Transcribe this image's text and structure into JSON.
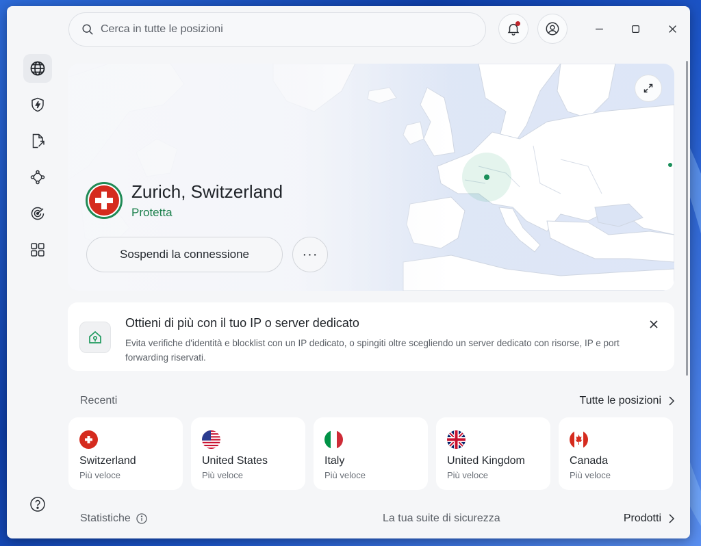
{
  "search": {
    "placeholder": "Cerca in tutte le posizioni"
  },
  "header": {
    "notifications_icon": "bell-icon",
    "account_icon": "account-icon",
    "window_controls": [
      "minimize",
      "maximize",
      "close"
    ]
  },
  "sidebar": {
    "items": [
      {
        "icon": "globe-icon",
        "active": true
      },
      {
        "icon": "shield-bolt-icon"
      },
      {
        "icon": "file-share-icon"
      },
      {
        "icon": "mesh-network-icon"
      },
      {
        "icon": "target-icon"
      },
      {
        "icon": "apps-grid-icon"
      }
    ],
    "help_icon": "help-icon"
  },
  "connection": {
    "location": "Zurich, Switzerland",
    "status": "Protetta",
    "pause_label": "Sospendi la connessione",
    "more_label": "···",
    "status_color": "#1a7f4b"
  },
  "promo": {
    "title": "Ottieni di più con il tuo IP o server dedicato",
    "description": "Evita verifiche d'identità e blocklist con un IP dedicato, o spingiti oltre scegliendo un server dedicato con risorse, IP e port forwarding riservati."
  },
  "recents": {
    "label": "Recenti",
    "all_label": "Tutte le posizioni",
    "items": [
      {
        "name": "Switzerland",
        "sub": "Più veloce",
        "flag": "switzerland-flag"
      },
      {
        "name": "United States",
        "sub": "Più veloce",
        "flag": "usa-flag"
      },
      {
        "name": "Italy",
        "sub": "Più veloce",
        "flag": "italy-flag"
      },
      {
        "name": "United Kingdom",
        "sub": "Più veloce",
        "flag": "uk-flag"
      },
      {
        "name": "Canada",
        "sub": "Più veloce",
        "flag": "canada-flag"
      }
    ]
  },
  "bottom": {
    "stats_label": "Statistiche",
    "suite_label": "La tua suite di sicurezza",
    "products_label": "Prodotti"
  }
}
